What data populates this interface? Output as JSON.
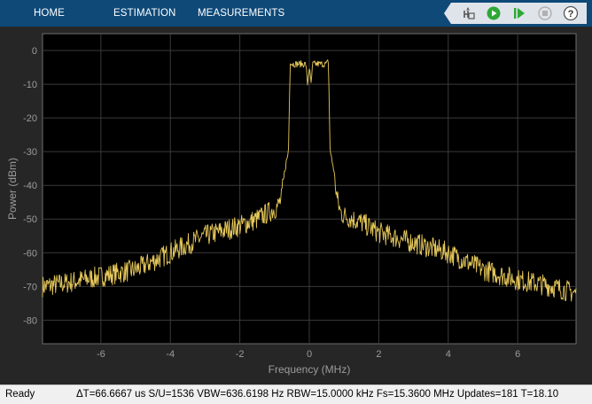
{
  "toolstrip": {
    "tabs": [
      "HOME",
      "ESTIMATION",
      "MEASUREMENTS"
    ],
    "background": "#0e4978"
  },
  "toolbar_icons": [
    "signal-select-icon",
    "run-icon",
    "step-forward-icon",
    "stop-icon",
    "help-icon"
  ],
  "status": {
    "ready": "Ready",
    "info": "ΔT=66.6667 us  S/U=1536  VBW=636.6198 Hz  RBW=15.0000 kHz  Fs=15.3600 MHz  Updates=181  T=18.10"
  },
  "chart_data": {
    "type": "line",
    "xlabel": "Frequency (MHz)",
    "ylabel": "Power (dBm)",
    "xlim": [
      -7.68,
      7.68
    ],
    "ylim": [
      -87,
      5
    ],
    "xticks": [
      -6,
      -4,
      -2,
      0,
      2,
      4,
      6
    ],
    "yticks": [
      0,
      -10,
      -20,
      -30,
      -40,
      -50,
      -60,
      -70,
      -80
    ],
    "grid": true,
    "line_color": "#e6c85a",
    "background": "#000000",
    "series": [
      {
        "x": [
          -7.68,
          -7.0,
          -6.0,
          -5.0,
          -4.0,
          -3.0,
          -2.0,
          -1.5,
          -1.0,
          -0.9,
          -0.8,
          -0.7,
          -0.6,
          -0.55,
          -0.5,
          -0.3,
          -0.1,
          -0.05,
          0.0,
          0.05,
          0.1,
          0.3,
          0.5,
          0.55,
          0.6,
          0.7,
          0.8,
          0.9,
          1.0,
          1.5,
          2.0,
          3.0,
          4.0,
          5.0,
          6.0,
          7.0,
          7.68
        ],
        "y": [
          -70,
          -69,
          -67,
          -65,
          -60,
          -55,
          -52,
          -50,
          -47,
          -46,
          -44,
          -35,
          -30,
          -3,
          -4,
          -4,
          -4,
          -10,
          -5,
          -10,
          -4,
          -4,
          -4,
          -3,
          -30,
          -35,
          -44,
          -48,
          -49,
          -51,
          -54,
          -57,
          -60,
          -65,
          -68,
          -70,
          -72
        ]
      }
    ]
  }
}
